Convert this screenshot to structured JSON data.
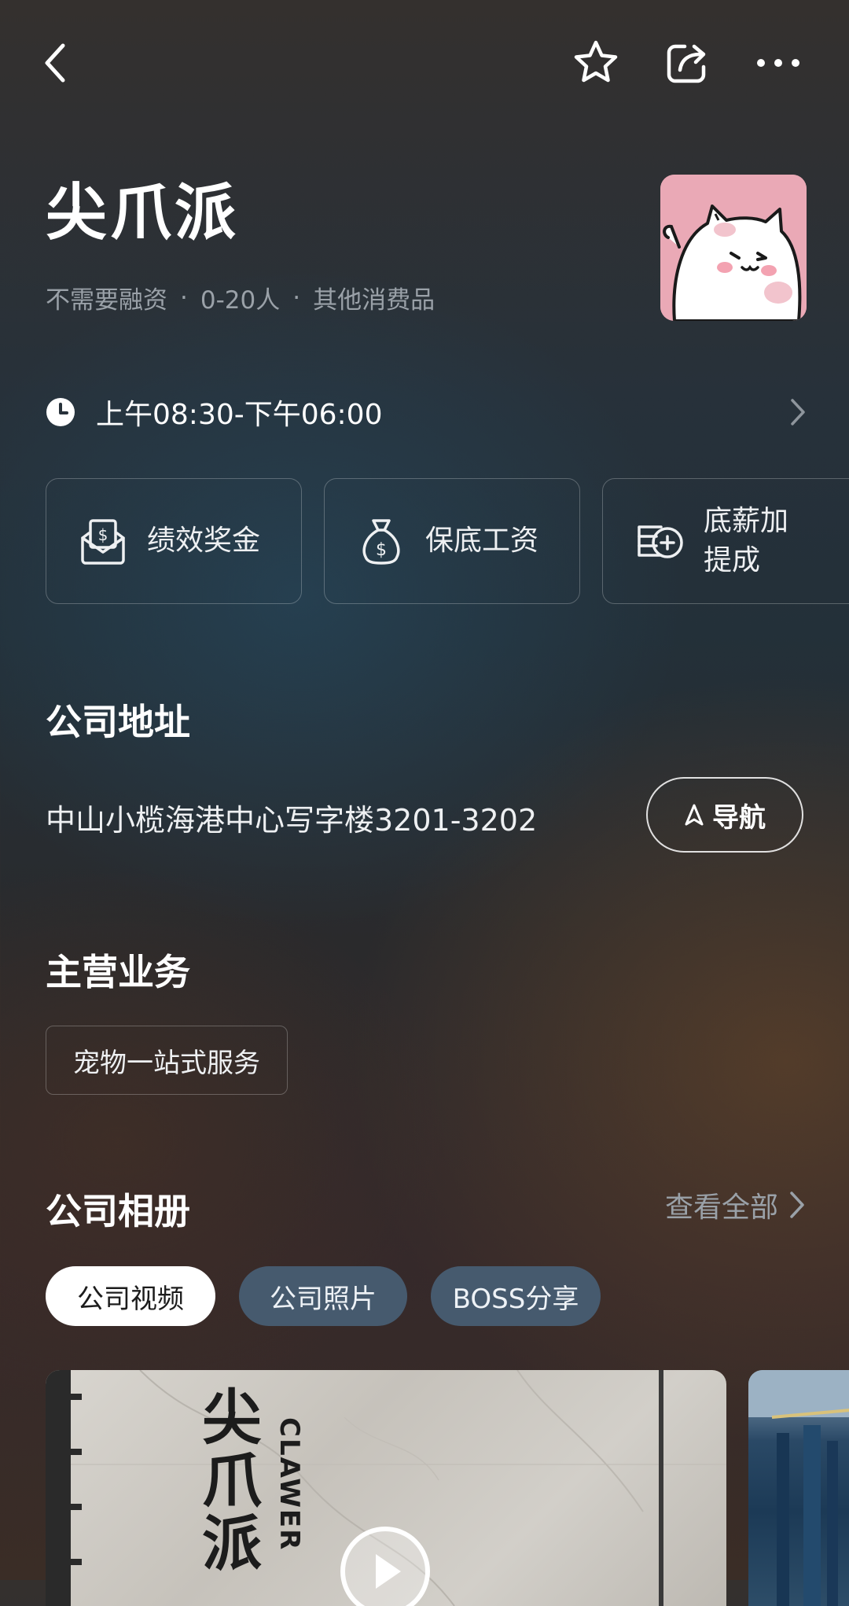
{
  "header": {
    "back_icon": "chevron-left-icon",
    "favorite_icon": "star-outline-icon",
    "share_icon": "share-icon",
    "more_icon": "more-dots-icon"
  },
  "company": {
    "name": "尖爪派",
    "financing": "不需要融资",
    "size": "0-20人",
    "industry": "其他消费品",
    "separator": "·",
    "logo_icon": "cat-logo"
  },
  "hours": {
    "icon": "clock-icon",
    "text": "上午08:30-下午06:00",
    "arrow_icon": "chevron-right-icon"
  },
  "benefits": [
    {
      "label": "绩效奖金",
      "icon": "bonus-envelope-icon"
    },
    {
      "label": "保底工资",
      "icon": "money-bag-icon"
    },
    {
      "label_line1": "底薪加",
      "label_line2": "提成",
      "icon": "coins-plus-icon"
    }
  ],
  "address_section": {
    "title": "公司地址",
    "address": "中山小榄海港中心写字楼3201-3202",
    "nav_label": "导航",
    "nav_icon": "navigation-arrow-icon"
  },
  "business_section": {
    "title": "主营业务",
    "tags": [
      "宠物一站式服务"
    ]
  },
  "album_section": {
    "title": "公司相册",
    "view_all": "查看全部",
    "tabs": [
      {
        "label": "公司视频",
        "active": true
      },
      {
        "label": "公司照片",
        "active": false
      },
      {
        "label": "BOSS分享",
        "active": false
      }
    ],
    "photo_sign_text": "尖爪派",
    "photo_sign_sub": "CLAWER",
    "play_icon": "play-icon"
  },
  "colors": {
    "muted_text": "#9aa1a8",
    "tab_inactive": "#465a6e",
    "logo_bg": "#eaa9b6"
  }
}
